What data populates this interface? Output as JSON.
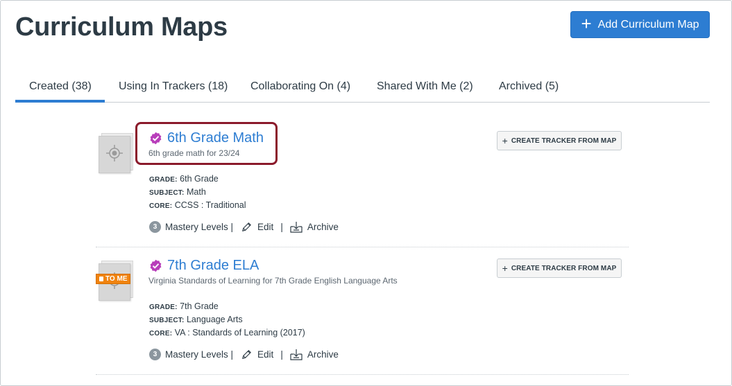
{
  "header": {
    "title": "Curriculum Maps",
    "add_button_label": "Add Curriculum Map"
  },
  "tabs": [
    {
      "label": "Created (38)",
      "active": true
    },
    {
      "label": "Using In Trackers (18)",
      "active": false
    },
    {
      "label": "Collaborating On (4)",
      "active": false
    },
    {
      "label": "Shared With Me (2)",
      "active": false
    },
    {
      "label": "Archived (5)",
      "active": false
    }
  ],
  "labels": {
    "grade": "GRADE:",
    "subject": "SUBJECT:",
    "core": "CORE:",
    "mastery_levels": "Mastery Levels |",
    "edit": "Edit",
    "archive": "Archive",
    "separator": "|",
    "create_tracker": "CREATE TRACKER FROM MAP",
    "to_me_badge": "TO ME"
  },
  "maps": [
    {
      "title": "6th Grade Math",
      "subtitle": "6th grade math for 23/24",
      "grade": "6th Grade",
      "subject": "Math",
      "core": "CCSS : Traditional",
      "mastery_count": "3"
    },
    {
      "title": "7th Grade ELA",
      "subtitle": "Virginia Standards of Learning for 7th Grade English Language Arts",
      "grade": "7th Grade",
      "subject": "Language Arts",
      "core": "VA : Standards of Learning (2017)",
      "mastery_count": "3"
    }
  ],
  "colors": {
    "accent": "#2d7dd2",
    "verified": "#b83dba",
    "badge_orange": "#f0830f",
    "highlight": "#8b1a2b"
  }
}
